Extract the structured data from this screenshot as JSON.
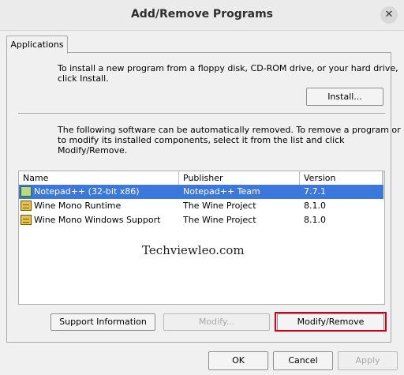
{
  "window": {
    "title": "Add/Remove Programs",
    "close_glyph": "✕"
  },
  "tab": {
    "label": "Applications"
  },
  "install": {
    "description_line1": "To install a new program from a floppy disk, CD-ROM drive, or your hard drive,",
    "description_line2": "click Install.",
    "button_label": "Install..."
  },
  "remove": {
    "description_line1": "The following software can be automatically removed. To remove a program or",
    "description_line2": "to modify its installed components, select it from the list and click",
    "description_line3": "Modify/Remove."
  },
  "list": {
    "columns": [
      "Name",
      "Publisher",
      "Version"
    ],
    "rows": [
      {
        "name": "Notepad++ (32-bit x86)",
        "publisher": "Notepad++ Team",
        "version": "7.7.1",
        "icon": "application-icon",
        "selected": true
      },
      {
        "name": "Wine Mono Runtime",
        "publisher": "The Wine Project",
        "version": "8.1.0",
        "icon": "package-icon",
        "selected": false
      },
      {
        "name": "Wine Mono Windows Support",
        "publisher": "The Wine Project",
        "version": "8.1.0",
        "icon": "package-icon",
        "selected": false
      }
    ],
    "selected_color": "#3c78dc"
  },
  "watermark": "Techviewleo.com",
  "actions": {
    "support_label": "Support Information",
    "modify_label": "Modify...",
    "modify_remove_label": "Modify/Remove",
    "highlight_color": "#d0021b"
  },
  "footer": {
    "ok_label": "OK",
    "cancel_label": "Cancel",
    "apply_label": "Apply"
  }
}
